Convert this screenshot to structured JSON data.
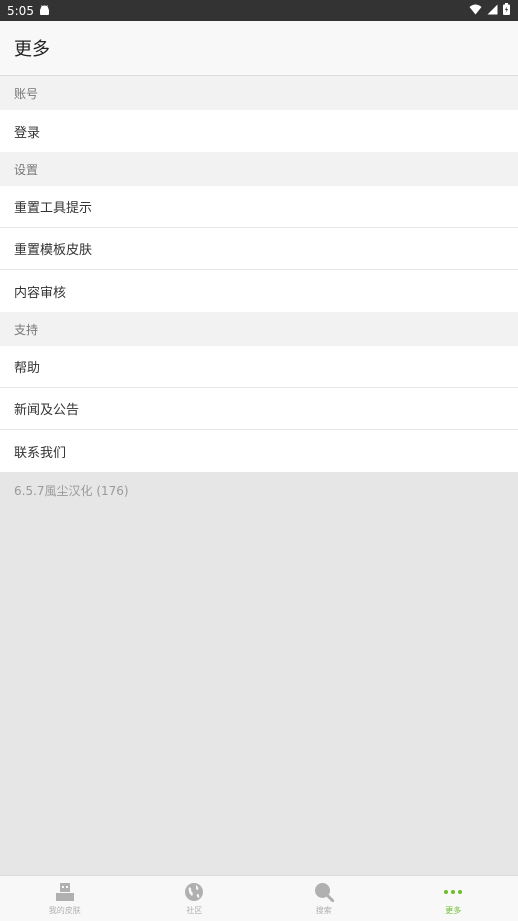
{
  "status_bar": {
    "time": "5:05"
  },
  "header": {
    "title": "更多"
  },
  "sections": [
    {
      "header": "账号",
      "items": [
        "登录"
      ]
    },
    {
      "header": "设置",
      "items": [
        "重置工具提示",
        "重置模板皮肤",
        "内容审核"
      ]
    },
    {
      "header": "支持",
      "items": [
        "帮助",
        "新闻及公告",
        "联系我们"
      ]
    }
  ],
  "version": "6.5.7風尘汉化 (176)",
  "tabs": [
    {
      "label": "我的皮肤",
      "icon": "skin-icon"
    },
    {
      "label": "社区",
      "icon": "globe-icon"
    },
    {
      "label": "搜索",
      "icon": "search-icon"
    },
    {
      "label": "更多",
      "icon": "more-icon",
      "active": true
    }
  ],
  "colors": {
    "accent": "#6cbf2c",
    "inactive": "#b0b0b0",
    "status_bar": "#333333"
  }
}
